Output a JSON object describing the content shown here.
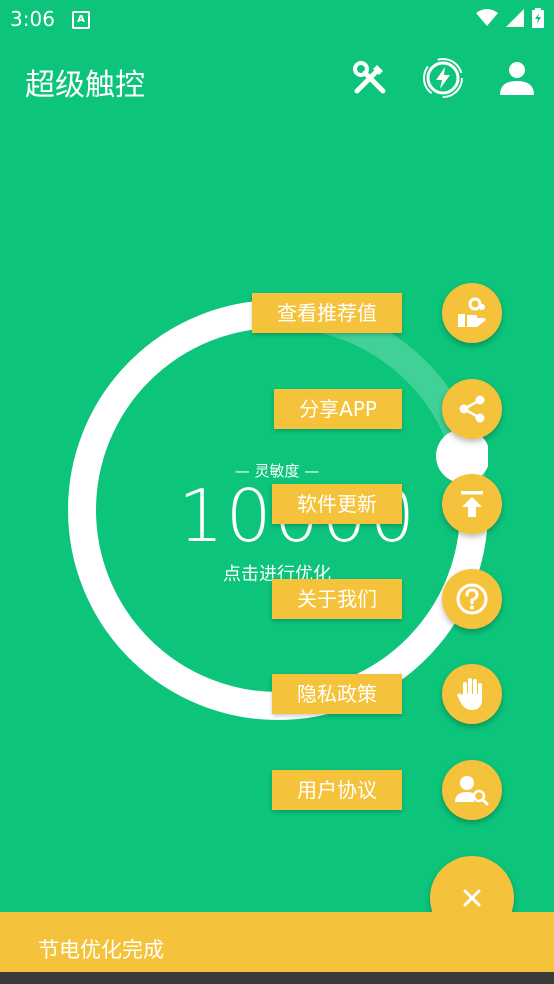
{
  "status": {
    "time": "3:06",
    "notif_badge": "A"
  },
  "app_bar": {
    "title": "超级触控",
    "icons": [
      "tools-icon",
      "power-boost-icon",
      "account-icon"
    ]
  },
  "gauge": {
    "label": "— 灵敏度 —",
    "value": "10000",
    "action": "点击进行优化",
    "level": 0.72
  },
  "fab_menu": {
    "items": [
      {
        "label": "查看推荐值",
        "icon": "recommend-hand-icon"
      },
      {
        "label": "分享APP",
        "icon": "share-icon"
      },
      {
        "label": "软件更新",
        "icon": "upload-icon"
      },
      {
        "label": "关于我们",
        "icon": "help-icon"
      },
      {
        "label": "隐私政策",
        "icon": "hand-icon"
      },
      {
        "label": "用户协议",
        "icon": "user-search-icon"
      }
    ],
    "close_icon": "close-icon"
  },
  "snackbar": {
    "message": "节电优化完成"
  },
  "colors": {
    "background": "#0cc47a",
    "accent": "#f5c33b",
    "white": "#ffffff"
  }
}
